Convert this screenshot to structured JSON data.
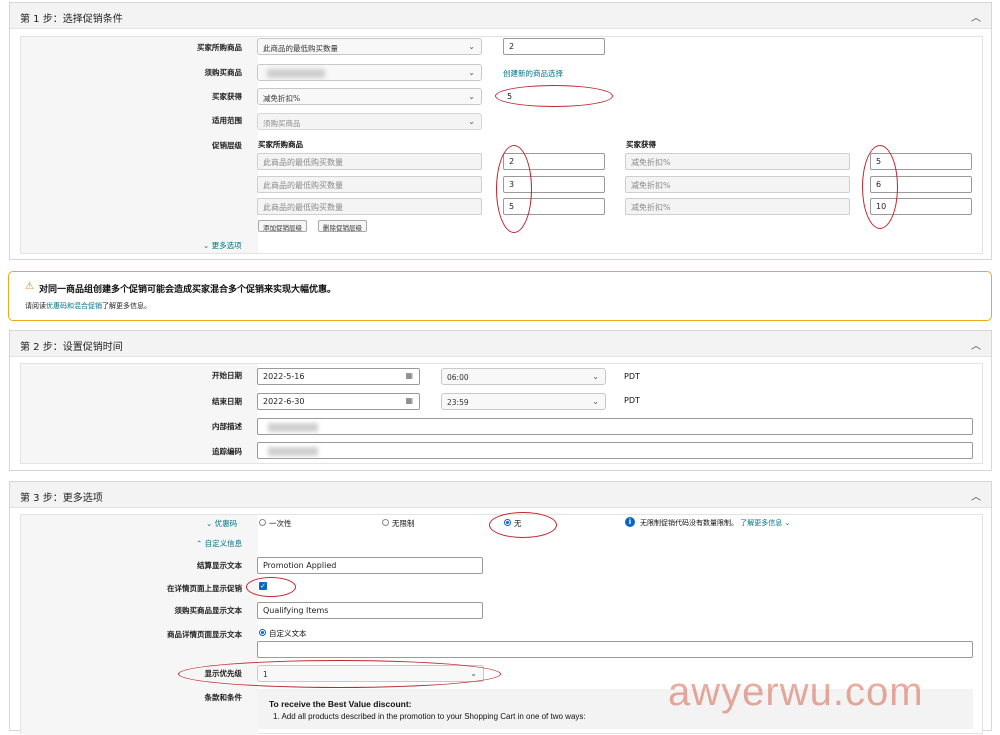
{
  "step1": {
    "title": "第 1 步：选择促销条件",
    "labels": {
      "buyer_purchase": "买家所购商品",
      "purchased_item": "须购买商品",
      "buyer_gets": "买家获得",
      "applies_to": "适用范围",
      "tiers": "促销层级"
    },
    "buyer_purchase_select": "此商品的最低购买数量",
    "buyer_purchase_value": "2",
    "create_selection_link": "创建新的商品选择",
    "buyer_gets_select": "减免折扣%",
    "buyer_gets_value": "5",
    "applies_to_select": "须购买商品",
    "tiers_header_left": "买家所购商品",
    "tiers_header_right": "买家获得",
    "tiers": [
      {
        "condition": "此商品的最低购买数量",
        "qty": "2",
        "benefit": "减免折扣%",
        "value": "5"
      },
      {
        "condition": "此商品的最低购买数量",
        "qty": "3",
        "benefit": "减免折扣%",
        "value": "6"
      },
      {
        "condition": "此商品的最低购买数量",
        "qty": "5",
        "benefit": "减免折扣%",
        "value": "10"
      }
    ],
    "add_tier": "添加促销层级",
    "remove_tier": "删除促销层级",
    "more_options": "更多选项"
  },
  "warning": {
    "title": "对同一商品组创建多个促销可能会造成买家混合多个促销来实现大幅优惠。",
    "body_prefix": "请阅读",
    "body_link": "优惠码和混合促销",
    "body_suffix": "了解更多信息。"
  },
  "step2": {
    "title": "第 2 步：设置促销时间",
    "labels": {
      "start": "开始日期",
      "end": "结束日期",
      "internal": "内部描述",
      "tracking": "追踪编码"
    },
    "start_date": "2022-5-16",
    "start_time": "06:00",
    "end_date": "2022-6-30",
    "end_time": "23:59",
    "tz": "PDT"
  },
  "step3": {
    "title": "第 3 步：更多选项",
    "coupon_label": "优惠码",
    "coupon_options": [
      "一次性",
      "无限制",
      "无"
    ],
    "coupon_info": "无限制促销代码没有数量限制。",
    "coupon_info_link": "了解更多信息",
    "custom_info": "自定义信息",
    "labels": {
      "checkout": "结算显示文本",
      "show_detail": "在详情页面上显示促销",
      "purchased_text": "须购买商品显示文本",
      "detail_text": "商品详情页面显示文本",
      "priority": "显示优先级",
      "terms": "条款和条件"
    },
    "checkout_value": "Promotion Applied",
    "purchased_value": "Qualifying Items",
    "detail_radio": "自定义文本",
    "priority_value": "1",
    "terms_title": "To receive the Best Value discount:",
    "terms_line": "1. Add all products described in the promotion to your Shopping Cart in one of two ways:"
  },
  "watermark": "awyerwu.com",
  "accent_color": "#c0262d"
}
